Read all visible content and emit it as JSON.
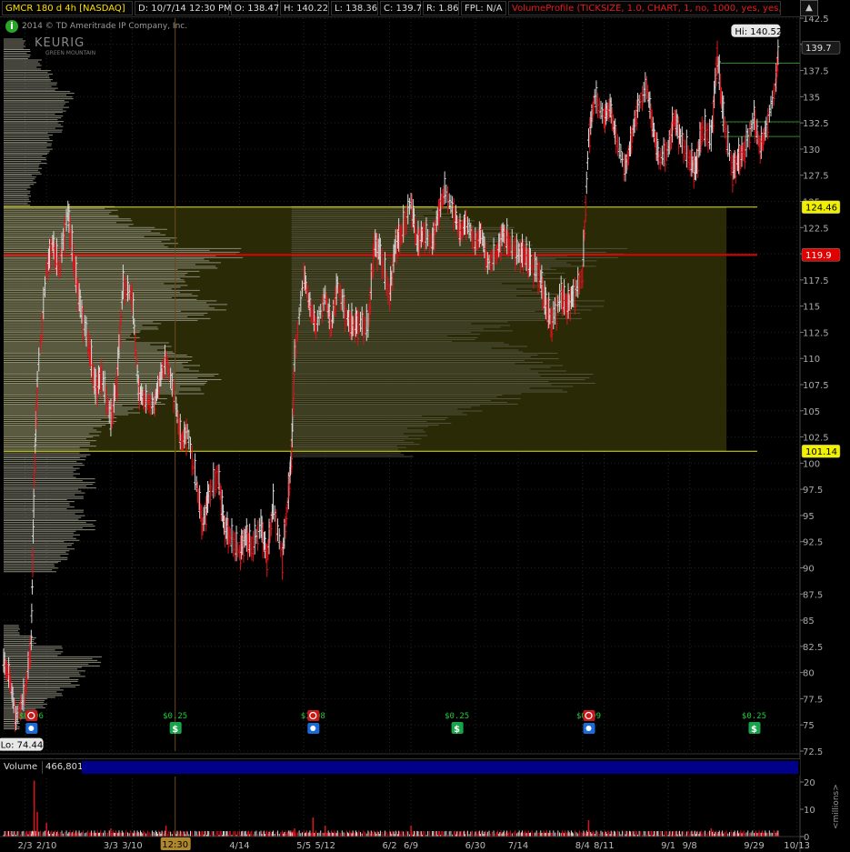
{
  "infobar": {
    "symbol": "GMCR 180 d 4h [NASDAQ]",
    "date": "D: 10/7/14 12:30 PM",
    "open": "O: 138.47",
    "high": "H: 140.22",
    "low": "L: 138.36",
    "close": "C: 139.7",
    "range": "R: 1.86",
    "fpl": "FPL: N/A",
    "study": "VolumeProfile (TICKSIZE, 1.0, CHART, 1, no, 1000, yes, yes,...",
    "button_icon": "chevron-up-icon",
    "button_glyph": "▲"
  },
  "watermark": {
    "copyright": "2014 © TD Ameritrade IP Company, Inc.",
    "logo": "KEURIG",
    "logo_sub": "GREEN MOUNTAIN",
    "info_glyph": "i"
  },
  "volume_panel": {
    "title": "Volume",
    "value": "466,801",
    "unit_label": "<millions>"
  },
  "colors": {
    "up": "#d9d9d9",
    "down": "#e0121a",
    "profile": "#8a8a7a",
    "value_area": "#2f2f08",
    "poc": "#e00000",
    "va_line": "#e8e800",
    "dividend": "#18a44a",
    "earnings": "#c81818",
    "cursor": "#6a4a1a"
  },
  "chart_data": {
    "type": "candlestick",
    "symbol": "GMCR",
    "timeframe": "180 d 4h",
    "ylim": [
      72.5,
      142.5
    ],
    "y_ticks": [
      142.5,
      140,
      137.5,
      135,
      132.5,
      130,
      127.5,
      125,
      122.5,
      120,
      117.5,
      115,
      112.5,
      110,
      107.5,
      105,
      102.5,
      100,
      97.5,
      95,
      92.5,
      90,
      87.5,
      85,
      82.5,
      80,
      77.5,
      75,
      72.5
    ],
    "x_tick_labels": [
      "2/3",
      "2/10",
      "3/3",
      "3/10",
      "4/14",
      "5/5",
      "5/12",
      "6/2",
      "6/9",
      "6/30",
      "7/14",
      "8/4",
      "8/11",
      "9/1",
      "9/8",
      "9/29",
      "10/13"
    ],
    "x_tick_dates": [
      "2014-02-03",
      "2014-02-10",
      "2014-03-03",
      "2014-03-10",
      "2014-04-14",
      "2014-05-05",
      "2014-05-12",
      "2014-06-02",
      "2014-06-09",
      "2014-06-30",
      "2014-07-14",
      "2014-08-04",
      "2014-08-11",
      "2014-09-01",
      "2014-09-08",
      "2014-09-29",
      "2014-10-13"
    ],
    "x_start": "2014-01-27",
    "x_end": "2014-10-14",
    "cursor_label": "12:30",
    "cursor_date": "2014-03-24",
    "price_path": [
      [
        "2014-01-27",
        81
      ],
      [
        "2014-01-29",
        79.5
      ],
      [
        "2014-01-31",
        75.5
      ],
      [
        "2014-02-03",
        78
      ],
      [
        "2014-02-05",
        83
      ],
      [
        "2014-02-06",
        98.5
      ],
      [
        "2014-02-07",
        108
      ],
      [
        "2014-02-10",
        118.5
      ],
      [
        "2014-02-12",
        121
      ],
      [
        "2014-02-14",
        118.5
      ],
      [
        "2014-02-17",
        124
      ],
      [
        "2014-02-19",
        119
      ],
      [
        "2014-02-21",
        115
      ],
      [
        "2014-02-24",
        111
      ],
      [
        "2014-02-26",
        107
      ],
      [
        "2014-02-28",
        108.5
      ],
      [
        "2014-03-03",
        104
      ],
      [
        "2014-03-05",
        108
      ],
      [
        "2014-03-07",
        117
      ],
      [
        "2014-03-10",
        116
      ],
      [
        "2014-03-12",
        107
      ],
      [
        "2014-03-14",
        106
      ],
      [
        "2014-03-17",
        105.5
      ],
      [
        "2014-03-19",
        108
      ],
      [
        "2014-03-21",
        110
      ],
      [
        "2014-03-24",
        106
      ],
      [
        "2014-03-26",
        102
      ],
      [
        "2014-03-28",
        103
      ],
      [
        "2014-03-31",
        98
      ],
      [
        "2014-04-02",
        94
      ],
      [
        "2014-04-04",
        97
      ],
      [
        "2014-04-07",
        99
      ],
      [
        "2014-04-09",
        94
      ],
      [
        "2014-04-11",
        93
      ],
      [
        "2014-04-14",
        91.5
      ],
      [
        "2014-04-16",
        93
      ],
      [
        "2014-04-18",
        92
      ],
      [
        "2014-04-21",
        94
      ],
      [
        "2014-04-23",
        91
      ],
      [
        "2014-04-25",
        96
      ],
      [
        "2014-04-28",
        91
      ],
      [
        "2014-04-30",
        97
      ],
      [
        "2014-05-01",
        101
      ],
      [
        "2014-05-02",
        110
      ],
      [
        "2014-05-05",
        118
      ],
      [
        "2014-05-07",
        115
      ],
      [
        "2014-05-09",
        113
      ],
      [
        "2014-05-12",
        116
      ],
      [
        "2014-05-14",
        113
      ],
      [
        "2014-05-16",
        117
      ],
      [
        "2014-05-19",
        114
      ],
      [
        "2014-05-21",
        113
      ],
      [
        "2014-05-23",
        113.5
      ],
      [
        "2014-05-26",
        113
      ],
      [
        "2014-05-28",
        121
      ],
      [
        "2014-05-30",
        120
      ],
      [
        "2014-06-02",
        116
      ],
      [
        "2014-06-04",
        121
      ],
      [
        "2014-06-06",
        122
      ],
      [
        "2014-06-09",
        125
      ],
      [
        "2014-06-11",
        121
      ],
      [
        "2014-06-13",
        122
      ],
      [
        "2014-06-16",
        121
      ],
      [
        "2014-06-18",
        124
      ],
      [
        "2014-06-20",
        126
      ],
      [
        "2014-06-23",
        124
      ],
      [
        "2014-06-25",
        122
      ],
      [
        "2014-06-27",
        123
      ],
      [
        "2014-06-30",
        121
      ],
      [
        "2014-07-02",
        122
      ],
      [
        "2014-07-04",
        119
      ],
      [
        "2014-07-07",
        120
      ],
      [
        "2014-07-09",
        122
      ],
      [
        "2014-07-11",
        121
      ],
      [
        "2014-07-14",
        120
      ],
      [
        "2014-07-16",
        120
      ],
      [
        "2014-07-18",
        119
      ],
      [
        "2014-07-21",
        118
      ],
      [
        "2014-07-23",
        115
      ],
      [
        "2014-07-25",
        113.5
      ],
      [
        "2014-07-28",
        116
      ],
      [
        "2014-07-30",
        115
      ],
      [
        "2014-08-01",
        116
      ],
      [
        "2014-08-04",
        118
      ],
      [
        "2014-08-06",
        131
      ],
      [
        "2014-08-08",
        135
      ],
      [
        "2014-08-11",
        133
      ],
      [
        "2014-08-13",
        134
      ],
      [
        "2014-08-15",
        131
      ],
      [
        "2014-08-18",
        128
      ],
      [
        "2014-08-20",
        131
      ],
      [
        "2014-08-22",
        134
      ],
      [
        "2014-08-25",
        136
      ],
      [
        "2014-08-27",
        132
      ],
      [
        "2014-08-29",
        129
      ],
      [
        "2014-09-01",
        130
      ],
      [
        "2014-09-03",
        133
      ],
      [
        "2014-09-05",
        131
      ],
      [
        "2014-09-08",
        129
      ],
      [
        "2014-09-10",
        128
      ],
      [
        "2014-09-12",
        132
      ],
      [
        "2014-09-15",
        131
      ],
      [
        "2014-09-17",
        139
      ],
      [
        "2014-09-19",
        133
      ],
      [
        "2014-09-22",
        128
      ],
      [
        "2014-09-24",
        129
      ],
      [
        "2014-09-26",
        130
      ],
      [
        "2014-09-29",
        133
      ],
      [
        "2014-10-01",
        130
      ],
      [
        "2014-10-03",
        132
      ],
      [
        "2014-10-06",
        136
      ],
      [
        "2014-10-07",
        139.7
      ]
    ],
    "hi_label": "Hi: 140.52",
    "hi_value": 140.52,
    "hi_date": "2014-10-07",
    "lo_label": "Lo: 74.44",
    "lo_value": 74.44,
    "lo_date": "2014-02-03",
    "last_price_label": "139.7",
    "last_price": 139.7,
    "volume_profile": {
      "upper_value_area": 124.46,
      "upper_label": "124.46",
      "poc": 119.9,
      "poc_label": "119.9",
      "lower_value_area": 101.14,
      "lower_label": "101.14",
      "value_area_end": "2014-09-20",
      "profile_bins": [
        [
          140,
          0.08
        ],
        [
          139,
          0.1
        ],
        [
          138,
          0.14
        ],
        [
          137,
          0.18
        ],
        [
          136,
          0.2
        ],
        [
          135,
          0.26
        ],
        [
          134,
          0.24
        ],
        [
          133,
          0.22
        ],
        [
          132,
          0.22
        ],
        [
          131,
          0.18
        ],
        [
          130,
          0.18
        ],
        [
          129,
          0.16
        ],
        [
          128,
          0.14
        ],
        [
          127,
          0.12
        ],
        [
          126,
          0.1
        ],
        [
          125,
          0.1
        ],
        [
          124,
          0.42
        ],
        [
          123,
          0.48
        ],
        [
          122,
          0.6
        ],
        [
          121,
          0.64
        ],
        [
          120,
          0.88
        ],
        [
          119,
          0.8
        ],
        [
          118,
          0.72
        ],
        [
          117,
          0.68
        ],
        [
          116,
          0.72
        ],
        [
          115,
          0.82
        ],
        [
          114,
          0.76
        ],
        [
          113,
          0.58
        ],
        [
          112,
          0.5
        ],
        [
          111,
          0.62
        ],
        [
          110,
          0.7
        ],
        [
          109,
          0.72
        ],
        [
          108,
          0.8
        ],
        [
          107,
          0.74
        ],
        [
          106,
          0.6
        ],
        [
          105,
          0.5
        ],
        [
          104,
          0.42
        ],
        [
          103,
          0.36
        ],
        [
          102,
          0.34
        ],
        [
          101,
          0.32
        ],
        [
          100,
          0.3
        ],
        [
          99,
          0.28
        ],
        [
          98,
          0.34
        ],
        [
          97,
          0.3
        ],
        [
          96,
          0.26
        ],
        [
          95,
          0.3
        ],
        [
          94,
          0.34
        ],
        [
          93,
          0.28
        ],
        [
          92,
          0.26
        ],
        [
          91,
          0.24
        ],
        [
          90,
          0.2
        ],
        [
          84,
          0.06
        ],
        [
          83,
          0.12
        ],
        [
          82,
          0.22
        ],
        [
          81,
          0.36
        ],
        [
          80,
          0.3
        ],
        [
          79,
          0.28
        ],
        [
          78,
          0.22
        ],
        [
          77,
          0.16
        ],
        [
          76,
          0.12
        ],
        [
          75,
          0.06
        ]
      ]
    },
    "levels_right": [
      {
        "price": 138.2,
        "color": "#2a8a2a"
      },
      {
        "price": 132.6,
        "color": "#2a8a2a"
      },
      {
        "price": 131.2,
        "color": "#2a8a2a"
      }
    ],
    "events": [
      {
        "type": "earnings",
        "label": "$0.96",
        "date": "2014-02-05",
        "icon": "alarm-clock-icon"
      },
      {
        "type": "dividend",
        "label": "$0.25",
        "date": "2014-03-24",
        "icon": "dollar-sign-icon"
      },
      {
        "type": "earnings",
        "label": "$1.08",
        "date": "2014-05-08",
        "icon": "alarm-clock-icon"
      },
      {
        "type": "dividend",
        "label": "$0.25",
        "date": "2014-06-24",
        "icon": "dollar-sign-icon"
      },
      {
        "type": "earnings",
        "label": "$0.99",
        "date": "2014-08-06",
        "icon": "alarm-clock-icon"
      },
      {
        "type": "dividend",
        "label": "$0.25",
        "date": "2014-09-29",
        "icon": "dollar-sign-icon"
      }
    ],
    "volume": {
      "ylim": [
        0,
        22
      ],
      "y_ticks": [
        0,
        10,
        20
      ],
      "unit": "millions",
      "spikes": [
        [
          "2014-02-06",
          20.5
        ],
        [
          "2014-02-07",
          9
        ],
        [
          "2014-02-10",
          5
        ],
        [
          "2014-03-03",
          3
        ],
        [
          "2014-03-21",
          4
        ],
        [
          "2014-05-02",
          3
        ],
        [
          "2014-05-08",
          7
        ],
        [
          "2014-05-12",
          4
        ],
        [
          "2014-06-09",
          4
        ],
        [
          "2014-08-06",
          6
        ],
        [
          "2014-09-15",
          3
        ],
        [
          "2014-10-07",
          0.5
        ]
      ]
    }
  }
}
